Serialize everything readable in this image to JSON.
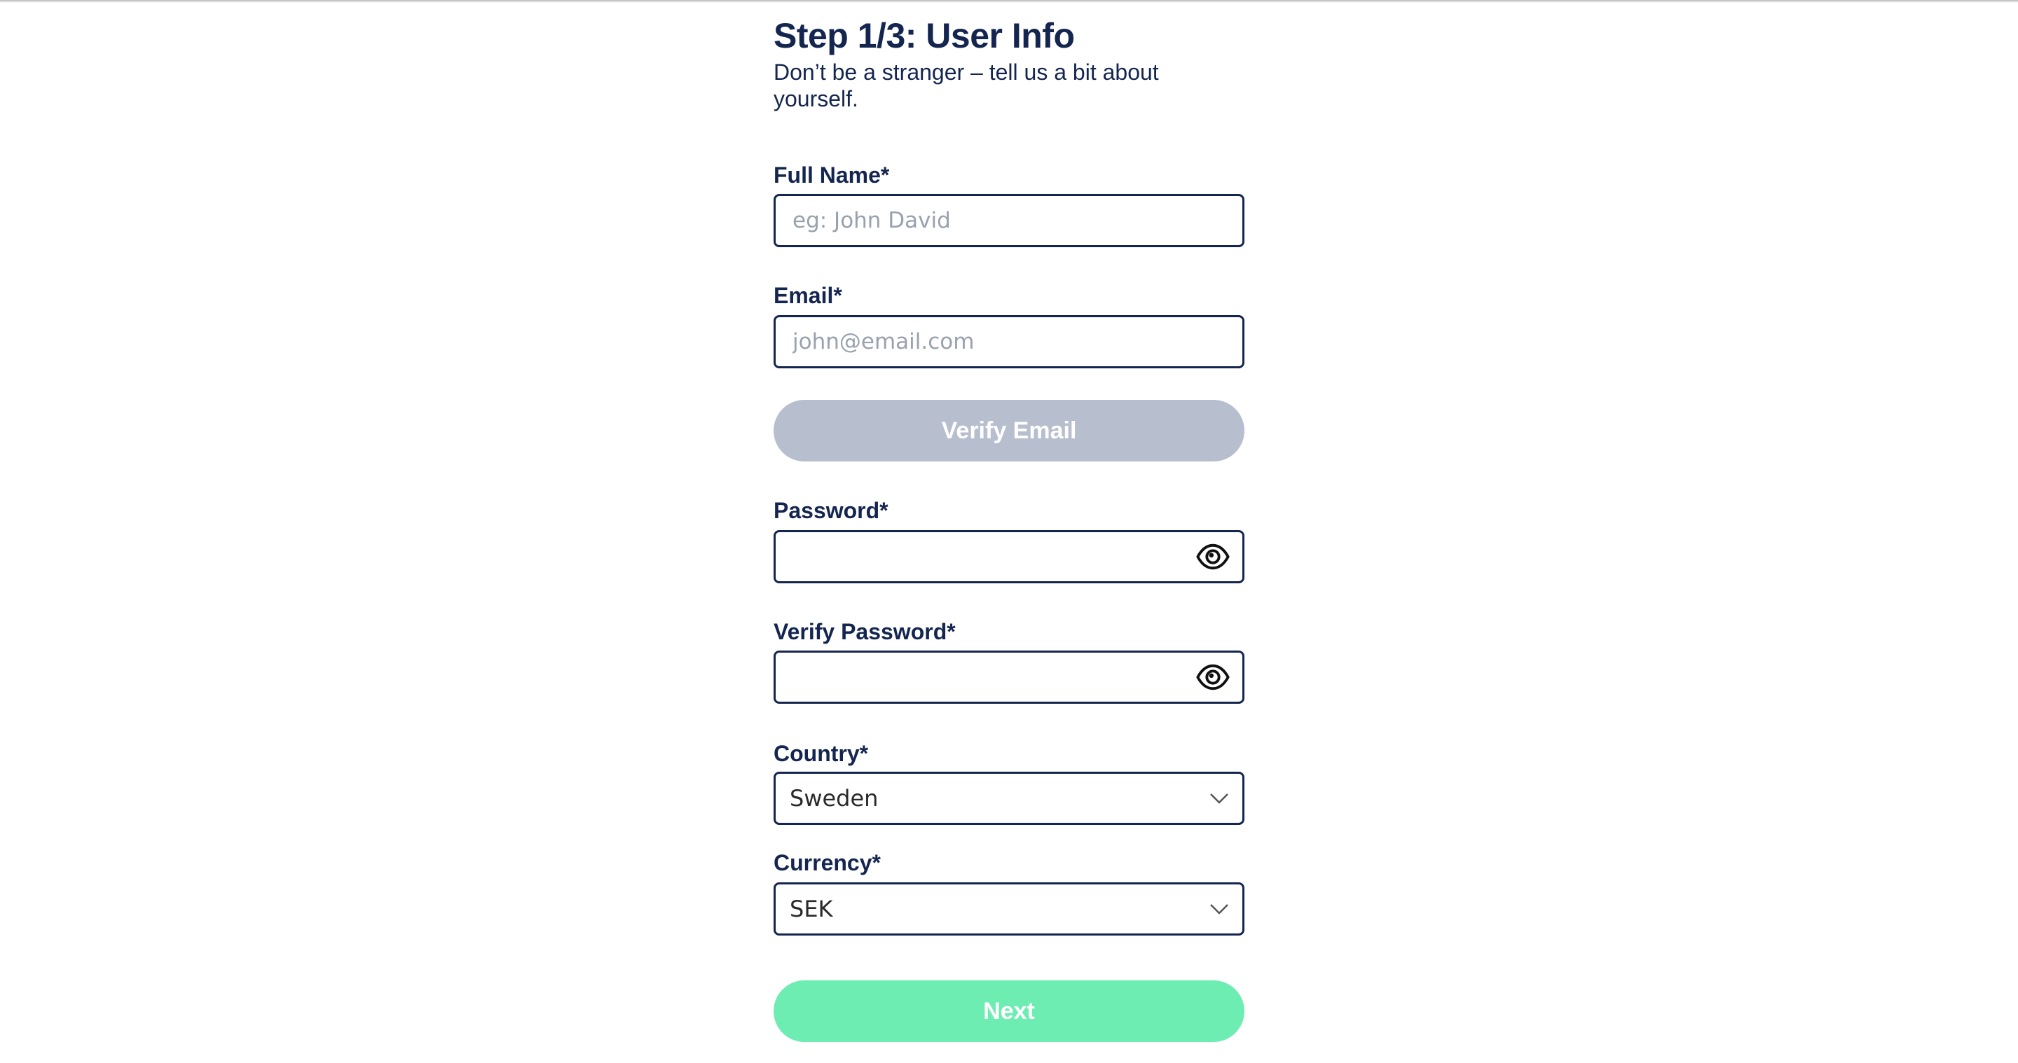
{
  "header": {
    "title": "Step 1/3: User Info",
    "subtitle": "Don’t be a stranger – tell us a bit about yourself."
  },
  "fields": {
    "full_name": {
      "label": "Full Name*",
      "placeholder": "eg: John David",
      "value": ""
    },
    "email": {
      "label": "Email*",
      "placeholder": "john@email.com",
      "value": ""
    },
    "password": {
      "label": "Password*",
      "value": "",
      "icon": "eye-icon"
    },
    "verify_password": {
      "label": "Verify Password*",
      "value": "",
      "icon": "eye-icon"
    },
    "country": {
      "label": "Country*",
      "selected": "Sweden",
      "icon": "chevron-down-icon"
    },
    "currency": {
      "label": "Currency*",
      "selected": "SEK",
      "icon": "chevron-down-icon"
    }
  },
  "buttons": {
    "verify_email": {
      "label": "Verify Email",
      "state": "disabled"
    },
    "next": {
      "label": "Next"
    }
  },
  "colors": {
    "primary_text": "#14264f",
    "disabled_button": "#b7bece",
    "next_button": "#6eedb2",
    "placeholder": "#9aa1ae"
  }
}
